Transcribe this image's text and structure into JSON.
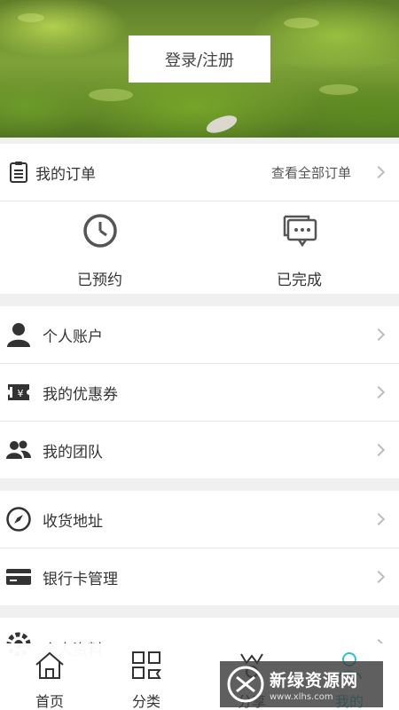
{
  "header": {
    "login_label": "登录/注册"
  },
  "orders": {
    "title": "我的订单",
    "view_all": "查看全部订单",
    "icon": "clipboard-icon"
  },
  "order_status": [
    {
      "label": "已预约",
      "icon": "clock-icon"
    },
    {
      "label": "已完成",
      "icon": "chat-bubble-icon"
    }
  ],
  "menu_group_1": [
    {
      "label": "个人账户",
      "icon": "person-icon"
    },
    {
      "label": "我的优惠券",
      "icon": "coupon-icon"
    },
    {
      "label": "我的团队",
      "icon": "team-icon"
    }
  ],
  "menu_group_2": [
    {
      "label": "收货地址",
      "icon": "compass-icon"
    },
    {
      "label": "银行卡管理",
      "icon": "card-icon"
    }
  ],
  "menu_group_3": [
    {
      "label": "个人资料",
      "icon": "gear-eye-icon"
    }
  ],
  "tabbar": [
    {
      "label": "首页",
      "icon": "home-icon",
      "active": false
    },
    {
      "label": "分类",
      "icon": "grid-icon",
      "active": false
    },
    {
      "label": "分享",
      "icon": "share-icon",
      "active": false
    },
    {
      "label": "我的",
      "icon": "user-icon",
      "active": true
    }
  ],
  "colors": {
    "accent": "#2ec1c8",
    "separator": "#f0f0f0",
    "text": "#333333",
    "chevron": "#bdbdbd"
  },
  "watermark": {
    "title": "新绿资源网",
    "url": "www.xlhs.com"
  }
}
